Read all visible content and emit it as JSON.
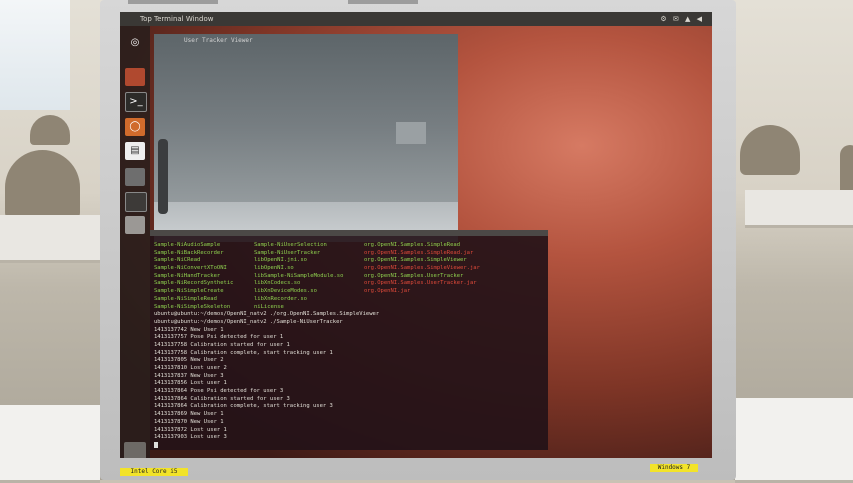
{
  "colors": {
    "accent_green": "#8fd14f",
    "accent_red": "#e04a3a",
    "desktop": "#b4543f"
  },
  "panel": {
    "window_title": "Top Terminal Window"
  },
  "viewer": {
    "title": "User Tracker Viewer"
  },
  "launcher": {
    "items": [
      {
        "icon": "dash-icon"
      },
      {
        "icon": "files-icon"
      },
      {
        "icon": "terminal-icon"
      },
      {
        "icon": "browser-icon"
      },
      {
        "icon": "document-icon"
      },
      {
        "icon": "workspace-icon"
      },
      {
        "icon": "app-icon"
      },
      {
        "icon": "drive-icon"
      }
    ]
  },
  "terminal": {
    "listing": [
      [
        "Sample-NiAudioSample",
        "Sample-NiUserSelection",
        "org.OpenNI.Samples.SimpleRead"
      ],
      [
        "Sample-NiBackRecorder",
        "Sample-NiUserTracker",
        "org.OpenNI.Samples.SimpleRead.jar"
      ],
      [
        "Sample-NiCRead",
        "libOpenNI.jni.so",
        "org.OpenNI.Samples.SimpleViewer"
      ],
      [
        "Sample-NiConvertXToONI",
        "libOpenNI.so",
        "org.OpenNI.Samples.SimpleViewer.jar"
      ],
      [
        "Sample-NiHandTracker",
        "libSample-NiSampleModule.so",
        "org.OpenNI.Samples.UserTracker"
      ],
      [
        "Sample-NiRecordSynthetic",
        "libXnCodecs.so",
        "org.OpenNI.Samples.UserTracker.jar"
      ],
      [
        "Sample-NiSimpleCreate",
        "libXnDeviceModes.so",
        "org.OpenNI.jar"
      ],
      [
        "Sample-NiSimpleRead",
        "libXnRecorder.so",
        ""
      ],
      [
        "Sample-NiSimpleSkeleton",
        "niLicense",
        ""
      ]
    ],
    "listing_colors": [
      [
        "green",
        "green",
        "green"
      ],
      [
        "green",
        "green",
        "red"
      ],
      [
        "green",
        "green",
        "green"
      ],
      [
        "green",
        "green",
        "red"
      ],
      [
        "green",
        "green",
        "green"
      ],
      [
        "green",
        "green",
        "red"
      ],
      [
        "green",
        "green",
        "red"
      ],
      [
        "green",
        "green",
        "white"
      ],
      [
        "green",
        "green",
        "white"
      ]
    ],
    "prompts": [
      "ubuntu@ubuntu:~/demos/OpenNI_natv2 ./org.OpenNI.Samples.SimpleViewer",
      "ubuntu@ubuntu:~/demos/OpenNI_natv2 ./Sample-NiUserTracker"
    ],
    "log": [
      "1413137742 New User 1",
      "1413137757 Pose Psi detected for user 1",
      "1413137758 Calibration started for user 1",
      "1413137758 Calibration complete, start tracking user 1",
      "1413137805 New User 2",
      "1413137810 Lost user 2",
      "1413137837 New User 3",
      "1413137856 Lost user 1",
      "1413137864 Pose Psi detected for user 3",
      "1413137864 Calibration started for user 3",
      "1413137864 Calibration complete, start tracking user 3",
      "1413137869 New User 1",
      "1413137870 New User 1",
      "1413137872 Lost user 1",
      "1413137903 Lost user 3"
    ]
  },
  "stickers": {
    "left": "Intel Core i5",
    "right": "Windows 7"
  }
}
